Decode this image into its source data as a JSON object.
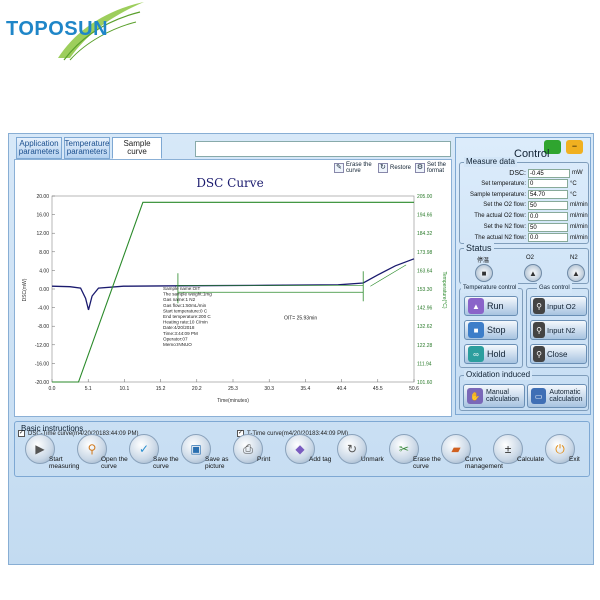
{
  "brand": {
    "name": "TOPOSUN"
  },
  "tabs": [
    {
      "label": "Application parameters"
    },
    {
      "label": "Temperature parameters"
    },
    {
      "label": "Sample curve"
    }
  ],
  "chart_toolbar": [
    {
      "label": "Erase the curve",
      "icon": "erase-icon"
    },
    {
      "label": "Restore",
      "icon": "restore-icon"
    },
    {
      "label": "Set the format",
      "icon": "format-icon"
    }
  ],
  "chart_data": {
    "type": "line",
    "title": "DSC Curve",
    "xlabel": "Time(minutes)",
    "ylabel_left": "DSC(mW)",
    "ylabel_right": "Temperature(°C)",
    "xlim": [
      0.0,
      50.6
    ],
    "ylim_left": [
      -20.0,
      20.0
    ],
    "ylim_right": [
      101.6,
      205.0
    ],
    "x_ticks": [
      "0.0",
      "5.1",
      "10.1",
      "15.2",
      "20.2",
      "25.3",
      "30.3",
      "35.4",
      "40.4",
      "45.5",
      "50.6"
    ],
    "y_ticks_left": [
      "20.00",
      "16.00",
      "12.00",
      "8.00",
      "4.00",
      "0.00",
      "-4.00",
      "-8.00",
      "-12.00",
      "-16.00",
      "-20.00"
    ],
    "y_ticks_right": [
      "205.00",
      "194.66",
      "184.32",
      "173.98",
      "163.64",
      "153.30",
      "142.96",
      "132.62",
      "122.28",
      "111.94",
      "101.60"
    ],
    "series": [
      {
        "name": "DSC-Time curve(m4/20/20183:44:09 PM)",
        "color": "#1a1a6e",
        "axis": "left",
        "points": [
          [
            0.0,
            0.6
          ],
          [
            2.5,
            0.5
          ],
          [
            4.0,
            0.2
          ],
          [
            4.7,
            -2.0
          ],
          [
            5.1,
            -4.5
          ],
          [
            5.6,
            -1.5
          ],
          [
            6.5,
            0.2
          ],
          [
            10,
            0.6
          ],
          [
            20,
            0.7
          ],
          [
            30,
            0.8
          ],
          [
            40,
            0.9
          ],
          [
            43.5,
            1.3
          ],
          [
            45.5,
            3.0
          ],
          [
            48,
            5.0
          ],
          [
            50.6,
            6.5
          ]
        ]
      },
      {
        "name": "T-Time curve(m4/20/20183:44:09 PM)",
        "color": "#2a8a2a",
        "axis": "right",
        "points": [
          [
            0.0,
            101.6
          ],
          [
            3.7,
            101.6
          ],
          [
            12.7,
            201.5
          ],
          [
            50.6,
            201.5
          ]
        ]
      }
    ],
    "annotations": {
      "sample_info": [
        "Sample name:OIT",
        "The sample weight:1mg",
        "Gas name:1 N2",
        "Gas flow:1:50mL/min",
        "Start temperature:0 C",
        "End temperature:200 C",
        "Heating rate:10 C/min",
        "Date:4/20/2018",
        "Time:3:44:09 PM",
        "Operator:07",
        "Memo:INNUO"
      ],
      "oit_label": "OIT= 25.93min",
      "oit_start": 17.6,
      "oit_end": 43.5
    }
  },
  "control": {
    "title": "Control",
    "measure": {
      "title": "Measure data",
      "rows": [
        {
          "label": "DSC:",
          "value": "-0.45",
          "unit": "mW"
        },
        {
          "label": "Set temperature:",
          "value": "0",
          "unit": "°C"
        },
        {
          "label": "Sample temperature:",
          "value": "54.70",
          "unit": "°C"
        },
        {
          "label": "Set the O2 flow:",
          "value": "50",
          "unit": "ml/min"
        },
        {
          "label": "The actual O2 flow:",
          "value": "0.0",
          "unit": "ml/min"
        },
        {
          "label": "Set the N2 flow:",
          "value": "50",
          "unit": "ml/min"
        },
        {
          "label": "The actual N2 flow:",
          "value": "0.0",
          "unit": "ml/min"
        }
      ]
    },
    "status": {
      "title": "Status",
      "items": [
        {
          "label": "停温"
        },
        {
          "label": "O2"
        },
        {
          "label": "N2"
        }
      ]
    },
    "temp_control": {
      "title": "Temperature control",
      "buttons": [
        {
          "label": "Run"
        },
        {
          "label": "Stop"
        },
        {
          "label": "Hold"
        }
      ]
    },
    "gas_control": {
      "title": "Gas control",
      "buttons": [
        {
          "label": "Input O2"
        },
        {
          "label": "Input N2"
        },
        {
          "label": "Close"
        }
      ]
    },
    "oxidation": {
      "title": "Oxidation induced",
      "buttons": [
        {
          "label": "Manual calculation"
        },
        {
          "label": "Automatic calculation"
        }
      ]
    }
  },
  "basic": {
    "title": "Basic instructions",
    "buttons": [
      {
        "label": "Start measuring",
        "icon": "play-icon"
      },
      {
        "label": "Open the curve",
        "icon": "magnifier-icon"
      },
      {
        "label": "Save the curve",
        "icon": "check-icon"
      },
      {
        "label": "Save as picture",
        "icon": "picture-icon"
      },
      {
        "label": "Print",
        "icon": "print-icon"
      },
      {
        "label": "Add tag",
        "icon": "tag-icon"
      },
      {
        "label": "Unmark",
        "icon": "refresh-icon"
      },
      {
        "label": "Erase the curve",
        "icon": "scissors-icon"
      },
      {
        "label": "Curve management",
        "icon": "folder-icon"
      },
      {
        "label": "Calculate",
        "icon": "calculator-icon"
      },
      {
        "label": "Exit",
        "icon": "power-icon"
      }
    ]
  }
}
